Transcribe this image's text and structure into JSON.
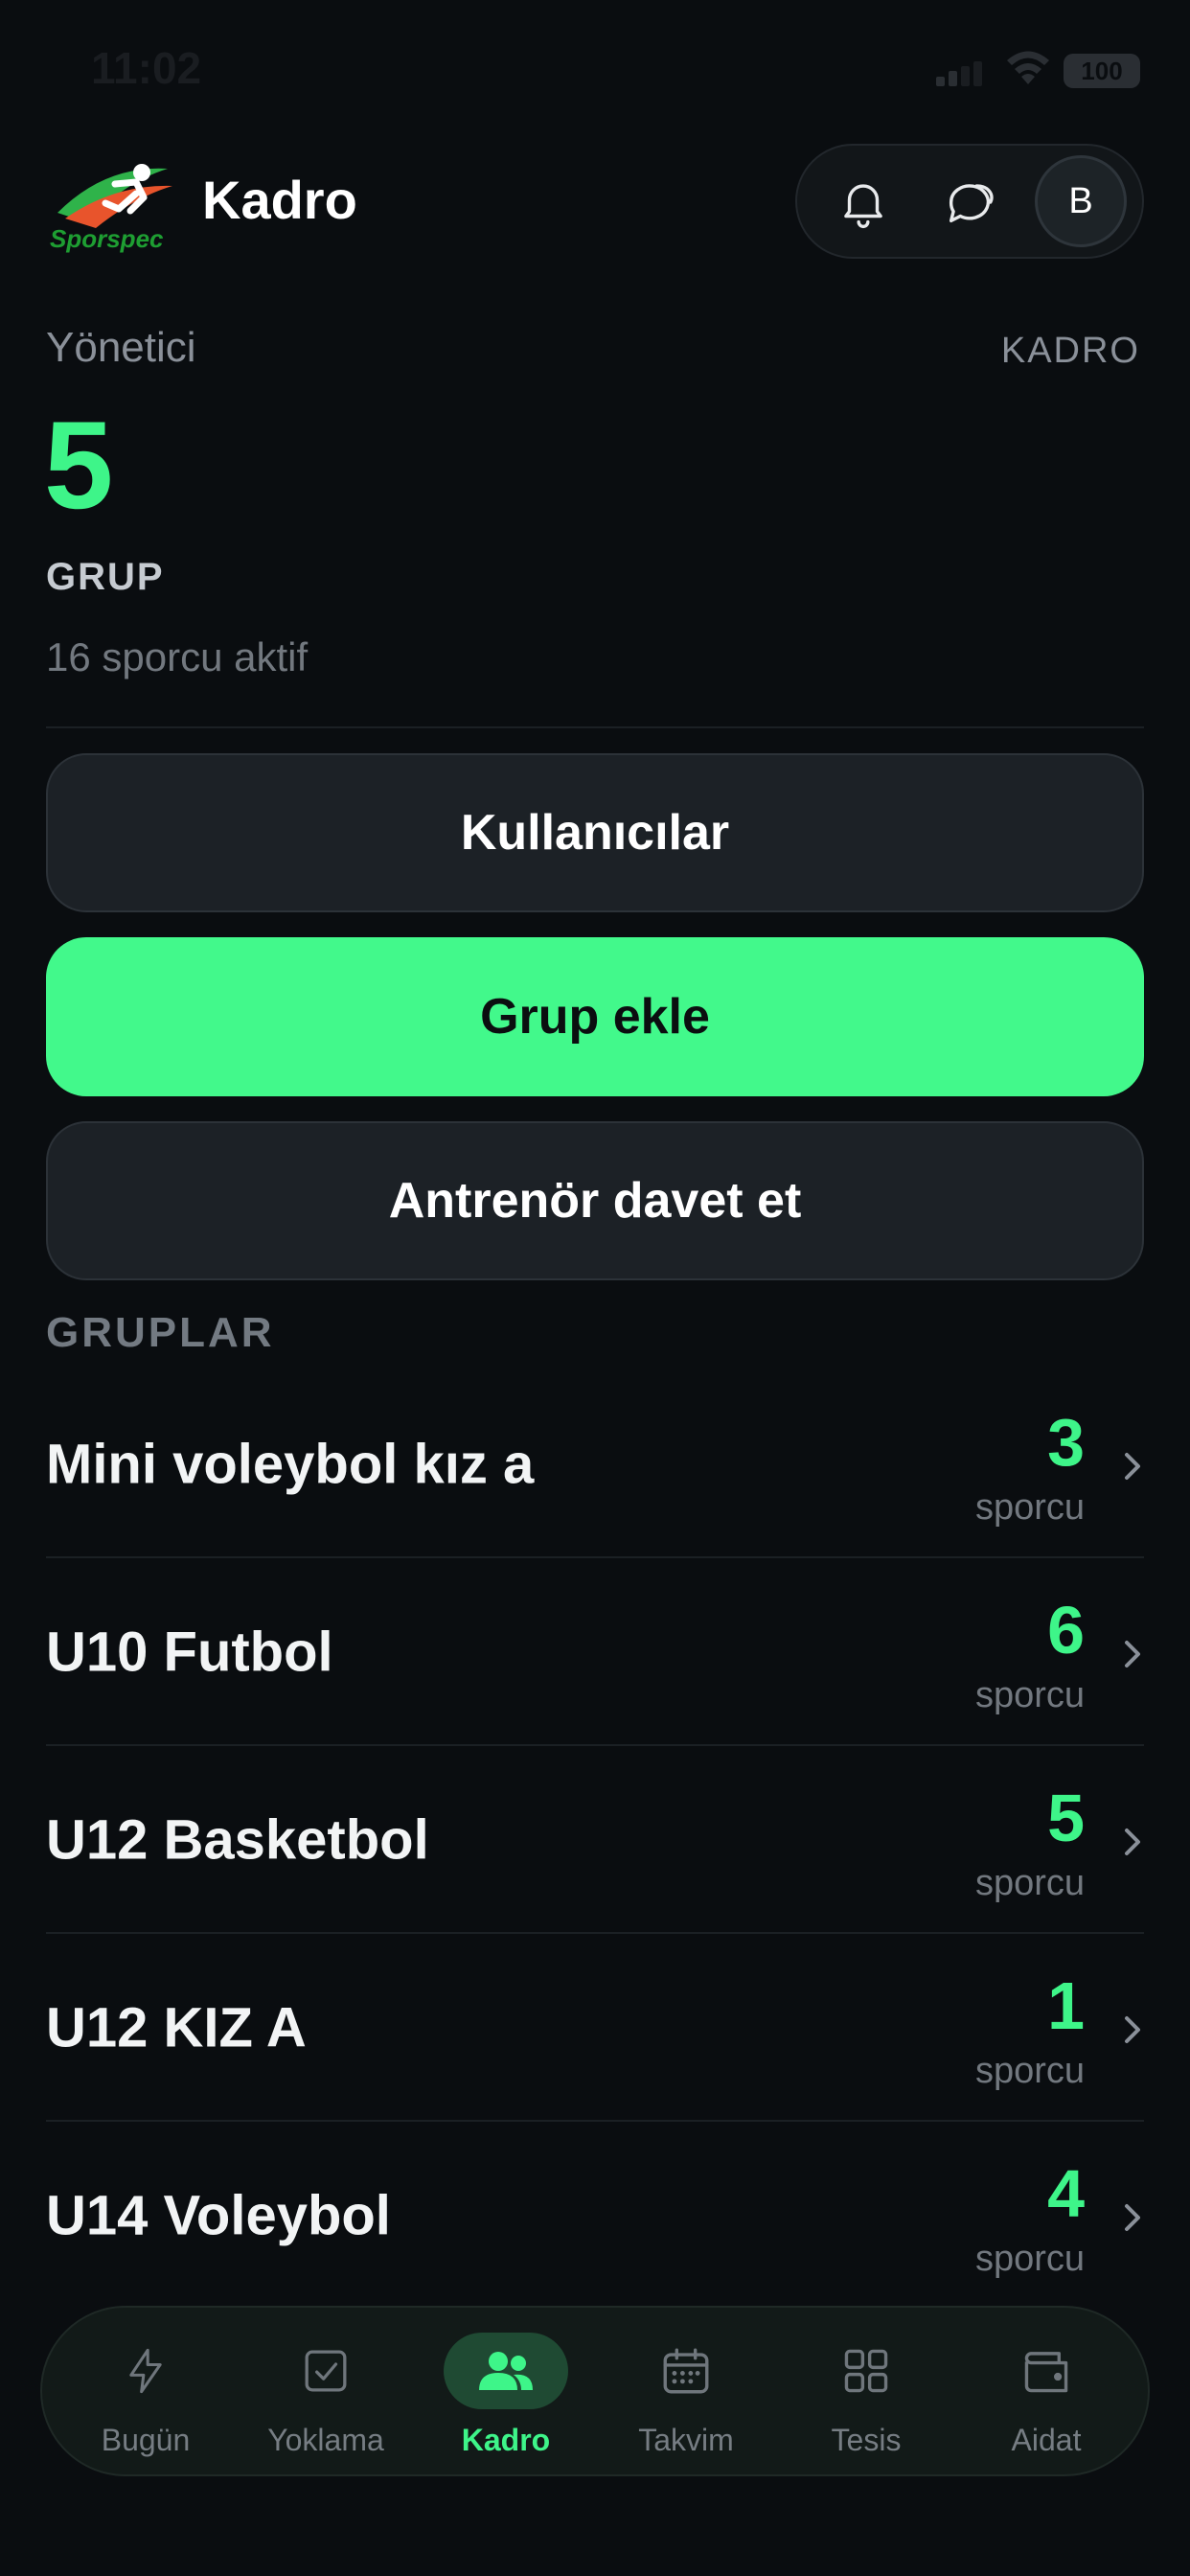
{
  "status_bar": {
    "time": "11:02",
    "battery": "100"
  },
  "header": {
    "logo_text": "Sporspec",
    "title": "Kadro",
    "avatar_letter": "B"
  },
  "summary": {
    "role": "Yönetici",
    "tag": "KADRO",
    "count": "5",
    "count_label": "GRUP",
    "active_text": "16 sporcu aktif"
  },
  "actions": {
    "users": "Kullanıcılar",
    "add_group": "Grup ekle",
    "invite_coach": "Antrenör davet et"
  },
  "groups": {
    "section_title": "GRUPLAR",
    "items": [
      {
        "name": "Mini voleybol kız a",
        "count": "3",
        "unit": "sporcu"
      },
      {
        "name": "U10 Futbol",
        "count": "6",
        "unit": "sporcu"
      },
      {
        "name": "U12 Basketbol",
        "count": "5",
        "unit": "sporcu"
      },
      {
        "name": "U12 KIZ A",
        "count": "1",
        "unit": "sporcu"
      },
      {
        "name": "U14 Voleybol",
        "count": "4",
        "unit": "sporcu"
      }
    ]
  },
  "nav": {
    "items": [
      {
        "label": "Bugün",
        "icon": "lightning-icon"
      },
      {
        "label": "Yoklama",
        "icon": "checkbox-icon"
      },
      {
        "label": "Kadro",
        "icon": "users-icon"
      },
      {
        "label": "Takvim",
        "icon": "calendar-icon"
      },
      {
        "label": "Tesis",
        "icon": "grid-icon"
      },
      {
        "label": "Aidat",
        "icon": "wallet-icon"
      }
    ],
    "active": "Kadro"
  },
  "colors": {
    "accent": "#42f98b",
    "background": "#0a0d10",
    "surface": "#1c2126",
    "muted": "#8a9099"
  }
}
